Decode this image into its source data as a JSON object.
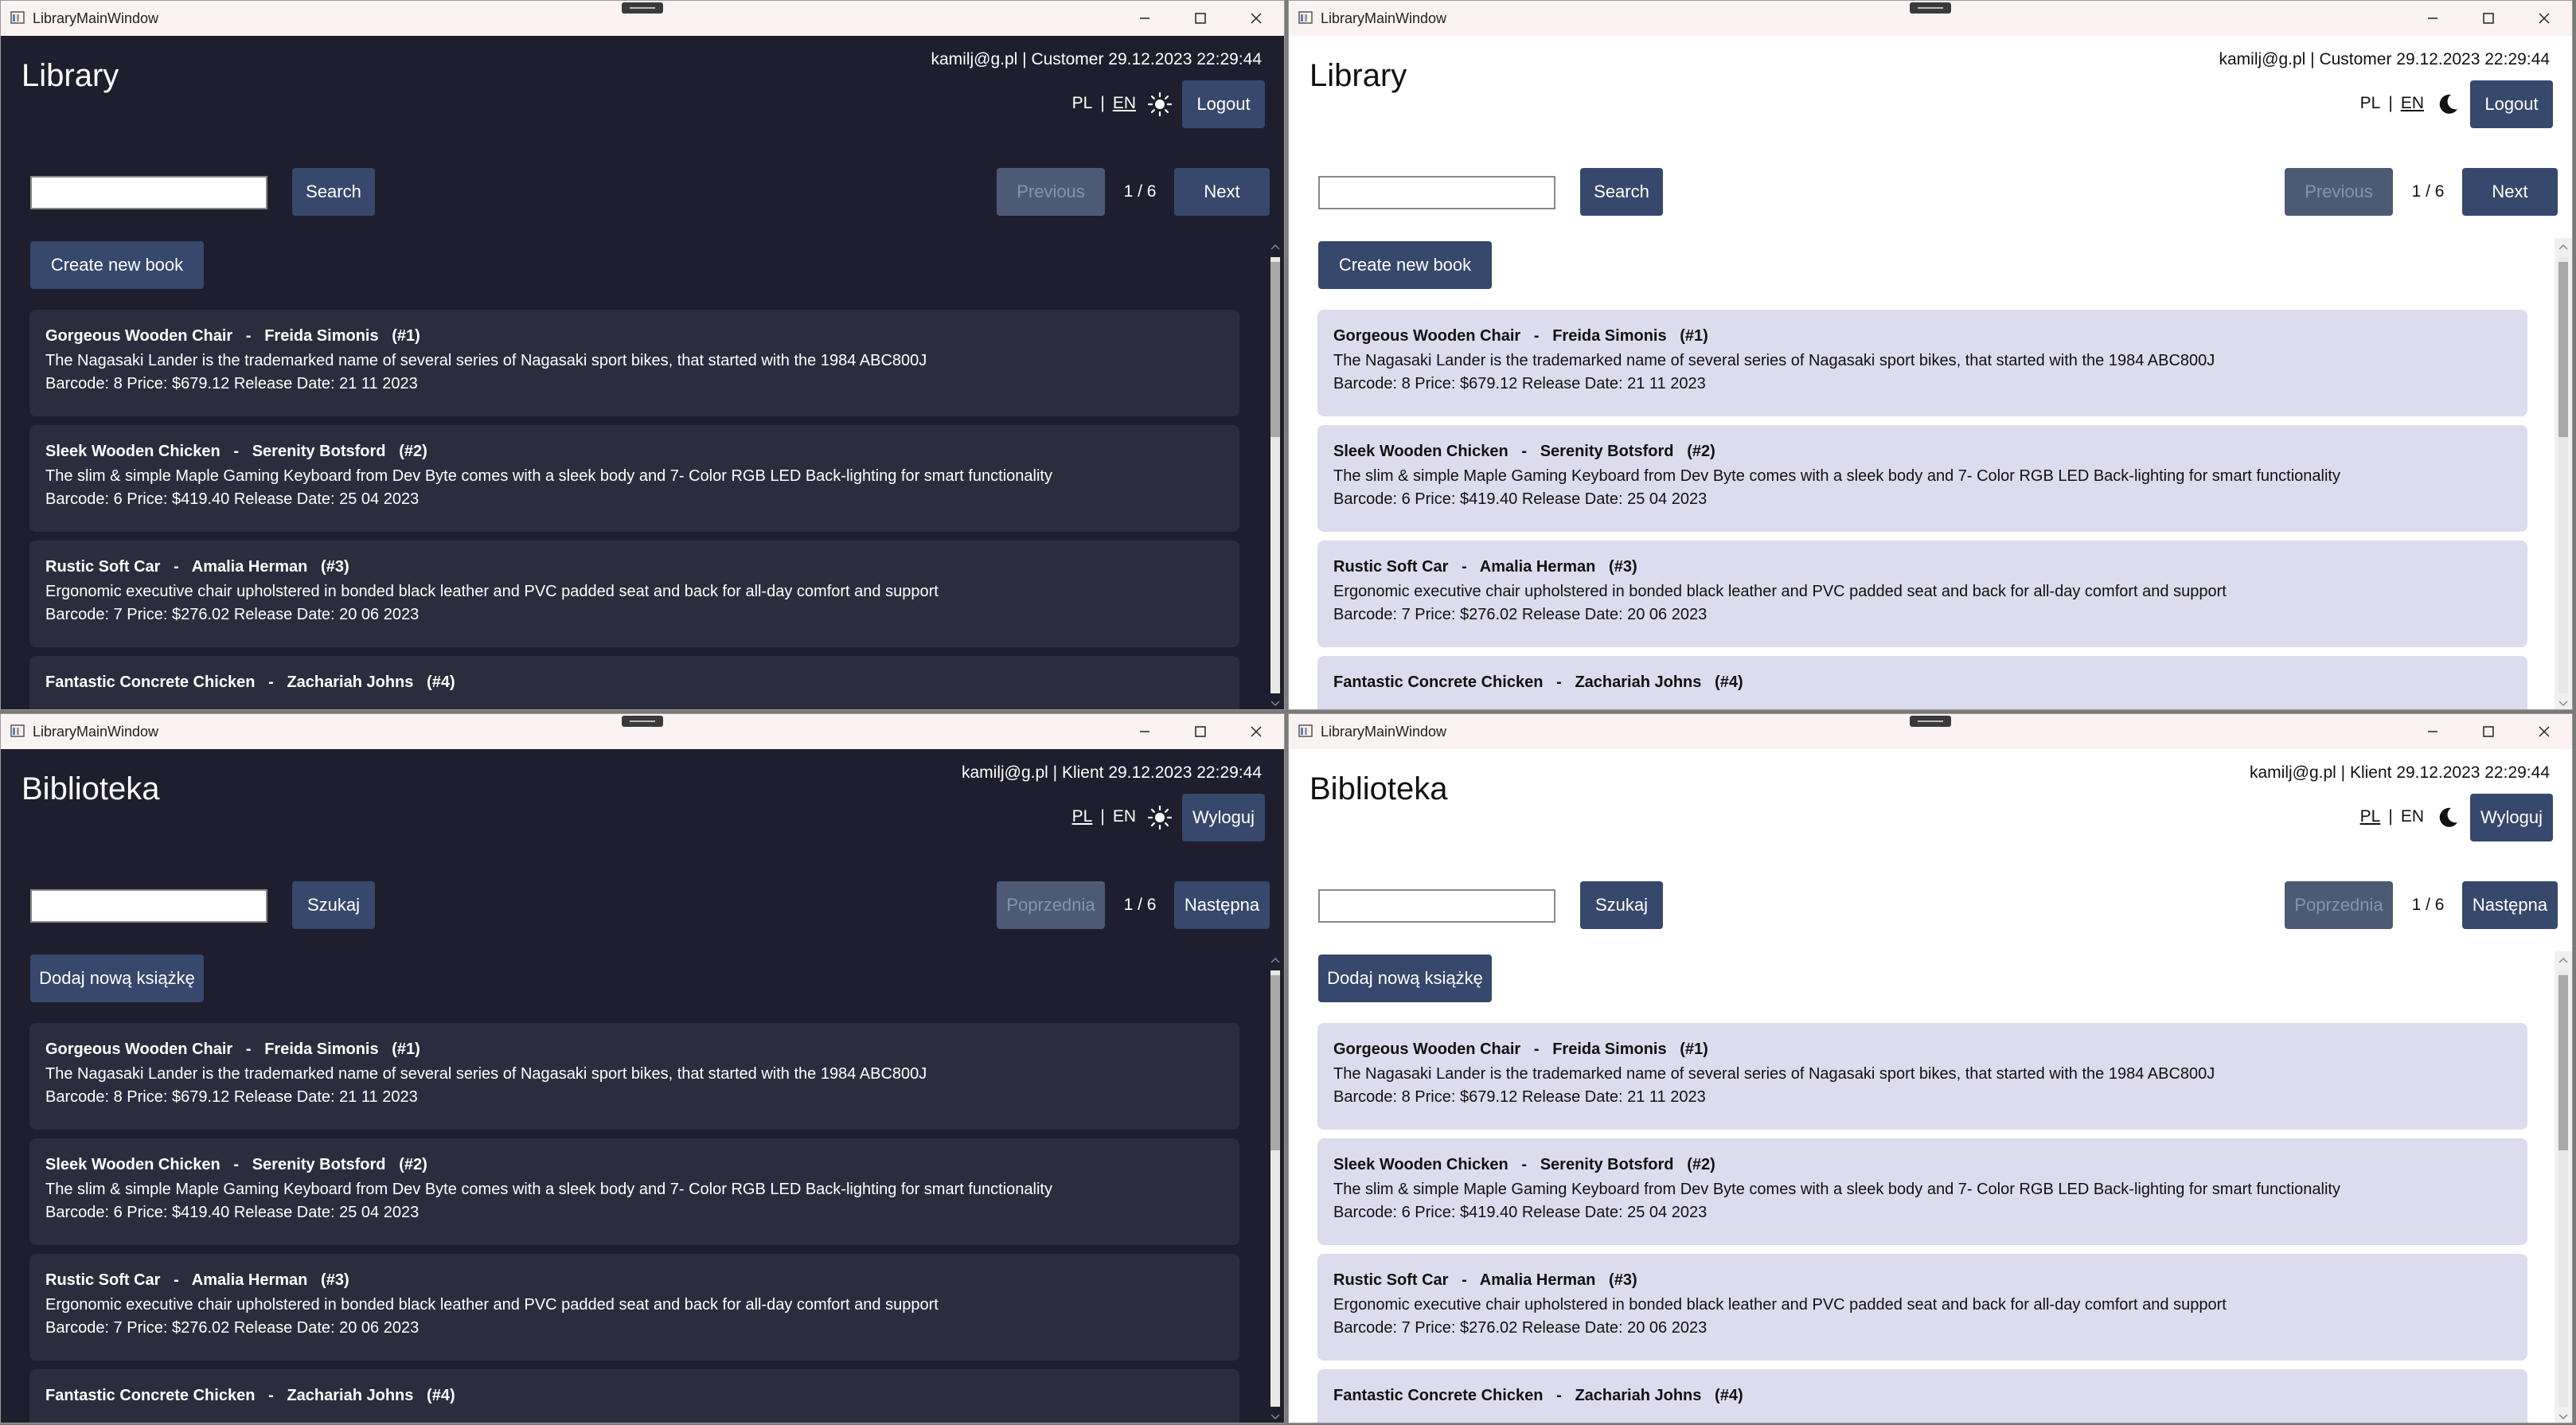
{
  "colors": {
    "dark_bg": "#1e1e2e",
    "dark_card": "#2b2d3f",
    "light_card": "#dddbee",
    "button": "#36486b",
    "button_disabled": "#4d5a74"
  },
  "icons": {
    "app": "app-window-icon",
    "minimize": "minimize-icon",
    "maximize": "maximize-icon",
    "close": "close-icon",
    "sun": "sun-icon",
    "moon": "moon-icon"
  },
  "windows": [
    {
      "theme": "dark",
      "window_title": "LibraryMainWindow",
      "app_title": "Library",
      "user_info": "kamilj@g.pl | Customer 29.12.2023 22:29:44",
      "lang_pl": "PL",
      "lang_sep": "|",
      "lang_en": "EN",
      "active_lang": "EN",
      "logout": "Logout",
      "search_value": "",
      "search_btn": "Search",
      "prev": "Previous",
      "page": "1 / 6",
      "next": "Next",
      "create": "Create new book",
      "books": [
        {
          "title": "Gorgeous Wooden Chair",
          "sep": "-",
          "author": "Freida Simonis",
          "id": "(#1)",
          "desc": "The Nagasaki Lander is the trademarked name of several series of Nagasaki sport bikes, that started with the 1984 ABC800J",
          "meta": "Barcode: 8  Price: $679.12  Release Date: 21 11 2023"
        },
        {
          "title": "Sleek Wooden Chicken",
          "sep": "-",
          "author": "Serenity Botsford",
          "id": "(#2)",
          "desc": "The slim & simple Maple Gaming Keyboard from Dev Byte comes with a sleek body and 7- Color RGB LED Back-lighting for smart functionality",
          "meta": "Barcode: 6  Price: $419.40  Release Date: 25 04 2023"
        },
        {
          "title": "Rustic Soft Car",
          "sep": "-",
          "author": "Amalia Herman",
          "id": "(#3)",
          "desc": "Ergonomic executive chair upholstered in bonded black leather and PVC padded seat and back for all-day comfort and support",
          "meta": "Barcode: 7  Price: $276.02  Release Date: 20 06 2023"
        },
        {
          "title": "Fantastic Concrete Chicken",
          "sep": "-",
          "author": "Zachariah Johns",
          "id": "(#4)",
          "desc": "",
          "meta": ""
        }
      ]
    },
    {
      "theme": "light",
      "window_title": "LibraryMainWindow",
      "app_title": "Library",
      "user_info": "kamilj@g.pl | Customer 29.12.2023 22:29:44",
      "lang_pl": "PL",
      "lang_sep": "|",
      "lang_en": "EN",
      "active_lang": "EN",
      "logout": "Logout",
      "search_value": "",
      "search_btn": "Search",
      "prev": "Previous",
      "page": "1 / 6",
      "next": "Next",
      "create": "Create new book",
      "books": [
        {
          "title": "Gorgeous Wooden Chair",
          "sep": "-",
          "author": "Freida Simonis",
          "id": "(#1)",
          "desc": "The Nagasaki Lander is the trademarked name of several series of Nagasaki sport bikes, that started with the 1984 ABC800J",
          "meta": "Barcode: 8  Price: $679.12  Release Date: 21 11 2023"
        },
        {
          "title": "Sleek Wooden Chicken",
          "sep": "-",
          "author": "Serenity Botsford",
          "id": "(#2)",
          "desc": "The slim & simple Maple Gaming Keyboard from Dev Byte comes with a sleek body and 7- Color RGB LED Back-lighting for smart functionality",
          "meta": "Barcode: 6  Price: $419.40  Release Date: 25 04 2023"
        },
        {
          "title": "Rustic Soft Car",
          "sep": "-",
          "author": "Amalia Herman",
          "id": "(#3)",
          "desc": "Ergonomic executive chair upholstered in bonded black leather and PVC padded seat and back for all-day comfort and support",
          "meta": "Barcode: 7  Price: $276.02  Release Date: 20 06 2023"
        },
        {
          "title": "Fantastic Concrete Chicken",
          "sep": "-",
          "author": "Zachariah Johns",
          "id": "(#4)",
          "desc": "",
          "meta": ""
        }
      ]
    },
    {
      "theme": "dark",
      "window_title": "LibraryMainWindow",
      "app_title": "Biblioteka",
      "user_info": "kamilj@g.pl | Klient 29.12.2023 22:29:44",
      "lang_pl": "PL",
      "lang_sep": "|",
      "lang_en": "EN",
      "active_lang": "PL",
      "logout": "Wyloguj",
      "search_value": "",
      "search_btn": "Szukaj",
      "prev": "Poprzednia",
      "page": "1 / 6",
      "next": "Następna",
      "create": "Dodaj nową książkę",
      "books": [
        {
          "title": "Gorgeous Wooden Chair",
          "sep": "-",
          "author": "Freida Simonis",
          "id": "(#1)",
          "desc": "The Nagasaki Lander is the trademarked name of several series of Nagasaki sport bikes, that started with the 1984 ABC800J",
          "meta": "Barcode: 8  Price: $679.12  Release Date: 21 11 2023"
        },
        {
          "title": "Sleek Wooden Chicken",
          "sep": "-",
          "author": "Serenity Botsford",
          "id": "(#2)",
          "desc": "The slim & simple Maple Gaming Keyboard from Dev Byte comes with a sleek body and 7- Color RGB LED Back-lighting for smart functionality",
          "meta": "Barcode: 6  Price: $419.40  Release Date: 25 04 2023"
        },
        {
          "title": "Rustic Soft Car",
          "sep": "-",
          "author": "Amalia Herman",
          "id": "(#3)",
          "desc": "Ergonomic executive chair upholstered in bonded black leather and PVC padded seat and back for all-day comfort and support",
          "meta": "Barcode: 7  Price: $276.02  Release Date: 20 06 2023"
        },
        {
          "title": "Fantastic Concrete Chicken",
          "sep": "-",
          "author": "Zachariah Johns",
          "id": "(#4)",
          "desc": "",
          "meta": ""
        }
      ]
    },
    {
      "theme": "light",
      "window_title": "LibraryMainWindow",
      "app_title": "Biblioteka",
      "user_info": "kamilj@g.pl | Klient 29.12.2023 22:29:44",
      "lang_pl": "PL",
      "lang_sep": "|",
      "lang_en": "EN",
      "active_lang": "PL",
      "logout": "Wyloguj",
      "search_value": "",
      "search_btn": "Szukaj",
      "prev": "Poprzednia",
      "page": "1 / 6",
      "next": "Następna",
      "create": "Dodaj nową książkę",
      "books": [
        {
          "title": "Gorgeous Wooden Chair",
          "sep": "-",
          "author": "Freida Simonis",
          "id": "(#1)",
          "desc": "The Nagasaki Lander is the trademarked name of several series of Nagasaki sport bikes, that started with the 1984 ABC800J",
          "meta": "Barcode: 8  Price: $679.12  Release Date: 21 11 2023"
        },
        {
          "title": "Sleek Wooden Chicken",
          "sep": "-",
          "author": "Serenity Botsford",
          "id": "(#2)",
          "desc": "The slim & simple Maple Gaming Keyboard from Dev Byte comes with a sleek body and 7- Color RGB LED Back-lighting for smart functionality",
          "meta": "Barcode: 6  Price: $419.40  Release Date: 25 04 2023"
        },
        {
          "title": "Rustic Soft Car",
          "sep": "-",
          "author": "Amalia Herman",
          "id": "(#3)",
          "desc": "Ergonomic executive chair upholstered in bonded black leather and PVC padded seat and back for all-day comfort and support",
          "meta": "Barcode: 7  Price: $276.02  Release Date: 20 06 2023"
        },
        {
          "title": "Fantastic Concrete Chicken",
          "sep": "-",
          "author": "Zachariah Johns",
          "id": "(#4)",
          "desc": "",
          "meta": ""
        }
      ]
    }
  ]
}
